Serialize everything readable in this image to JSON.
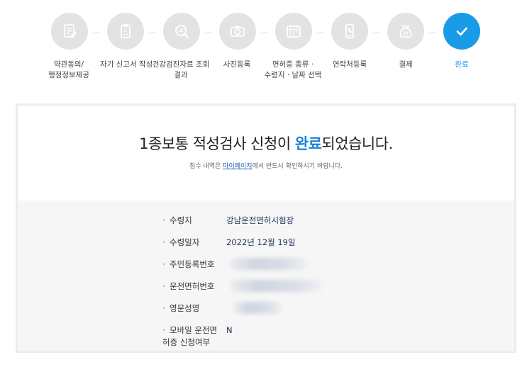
{
  "steps": [
    {
      "label_line1": "약관동의/",
      "label_line2": "행정정보제공",
      "icon": "document-icon"
    },
    {
      "label_line1": "자기 신고서 작성",
      "label_line2": "",
      "icon": "form-icon"
    },
    {
      "label_line1": "건강검진자료 조회",
      "label_line2": "결과",
      "icon": "search-icon"
    },
    {
      "label_line1": "사진등록",
      "label_line2": "",
      "icon": "camera-icon"
    },
    {
      "label_line1": "면허증 종류 ·",
      "label_line2": "수령지 · 날짜 선택",
      "icon": "calendar-icon"
    },
    {
      "label_line1": "연락처등록",
      "label_line2": "",
      "icon": "phone-icon"
    },
    {
      "label_line1": "결제",
      "label_line2": "",
      "icon": "won-bag-icon"
    },
    {
      "label_line1": "완료",
      "label_line2": "",
      "icon": "check-icon"
    }
  ],
  "headline": {
    "before": "1종보통 적성검사 신청이 ",
    "highlight": "완료",
    "after": "되었습니다."
  },
  "subline": {
    "before": "접수 내역은 ",
    "link": "마이페이지",
    "after": "에서 반드시 확인하시기 바랍니다."
  },
  "info": [
    {
      "label": "수령지",
      "value": "강남운전면허시험장"
    },
    {
      "label": "수령일자",
      "value": "2022년 12월 19일"
    },
    {
      "label": "주민등록번호",
      "value": ""
    },
    {
      "label": "운전면허번호",
      "value": ""
    },
    {
      "label": "영문성명",
      "value": ""
    },
    {
      "label_line1": "모바일 운전면",
      "label_line2": "허증 신청여부",
      "value": "N"
    }
  ],
  "colors": {
    "accent": "#1a9be8",
    "inactive": "#e3e3e3",
    "highlight": "#1a82d8"
  }
}
